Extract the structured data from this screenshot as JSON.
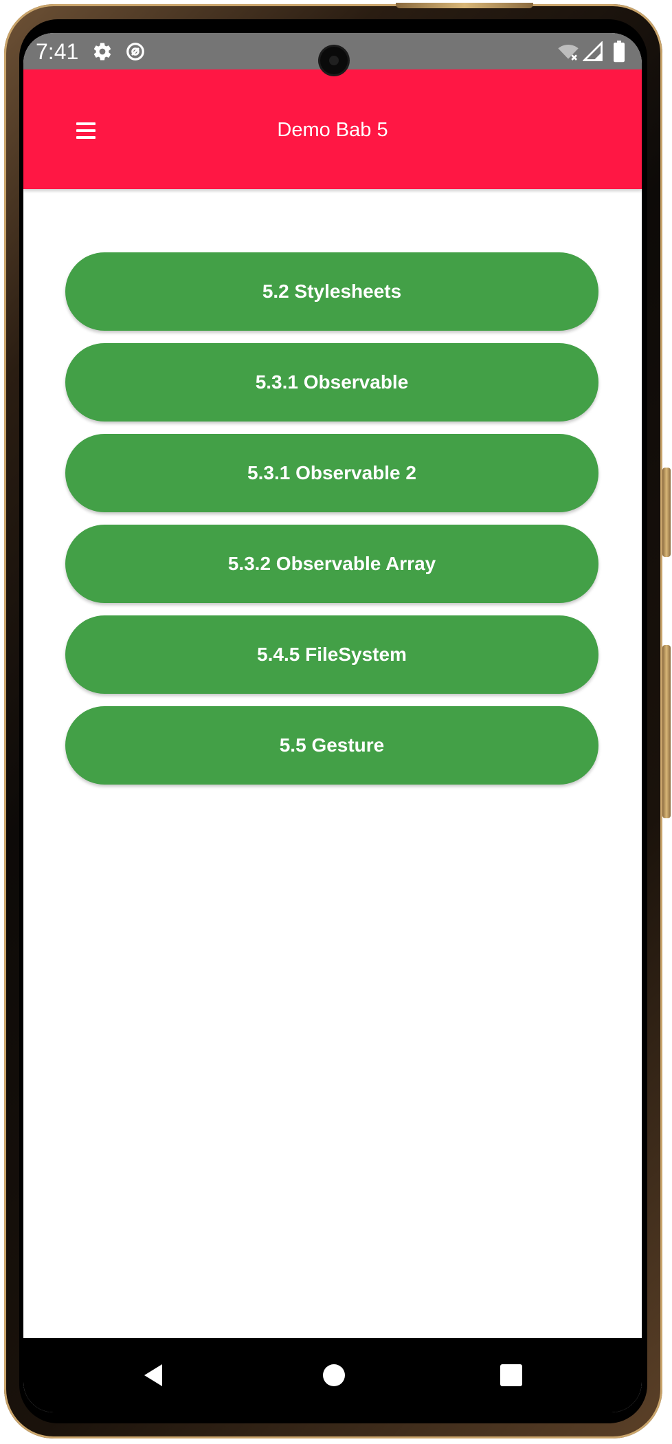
{
  "status_bar": {
    "time": "7:41",
    "left_icons": [
      "gear-icon",
      "at-sign-icon"
    ],
    "right_icons": [
      "wifi-off-icon",
      "signal-icon",
      "battery-icon"
    ],
    "background": "#757575"
  },
  "app_bar": {
    "title": "Demo Bab 5",
    "menu_icon": "hamburger-menu-icon",
    "background": "#ff1744"
  },
  "buttons": [
    {
      "label": "5.2 Stylesheets"
    },
    {
      "label": "5.3.1 Observable"
    },
    {
      "label": "5.3.1 Observable 2"
    },
    {
      "label": "5.3.2 Observable Array"
    },
    {
      "label": "5.4.5 FileSystem"
    },
    {
      "label": "5.5 Gesture"
    }
  ],
  "button_color": "#43a047",
  "system_nav": {
    "keys": [
      "back-icon",
      "home-icon",
      "recents-icon"
    ],
    "background": "#000000"
  }
}
